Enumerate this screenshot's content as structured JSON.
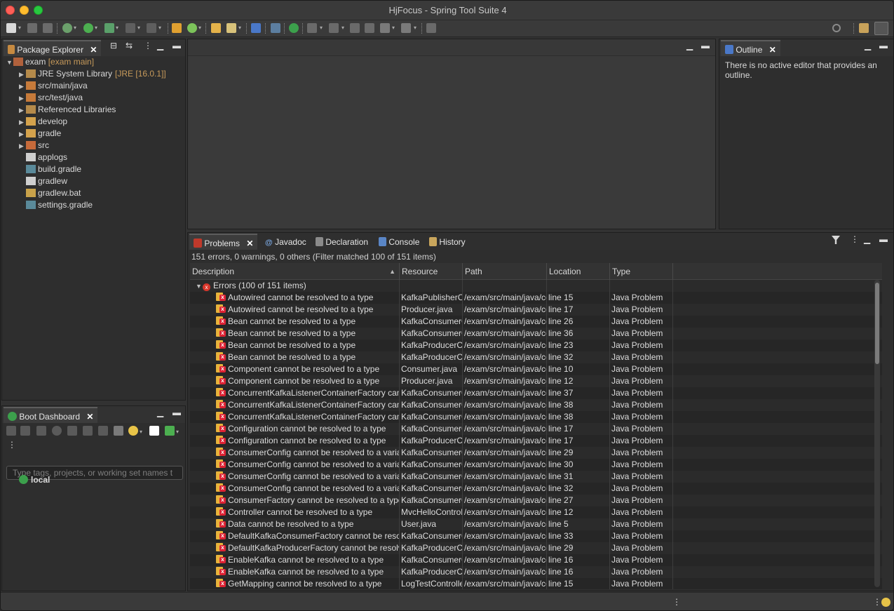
{
  "window": {
    "title": "HjFocus - Spring Tool Suite 4"
  },
  "package_explorer": {
    "tab_label": "Package Explorer",
    "project": {
      "name": "exam",
      "decoration": "[exam main]"
    },
    "children": [
      {
        "label": "JRE System Library",
        "decoration": "[JRE [16.0.1]]",
        "icon": "library-icon",
        "expandable": true
      },
      {
        "label": "src/main/java",
        "decoration": "",
        "icon": "package-folder-error-icon",
        "expandable": true
      },
      {
        "label": "src/test/java",
        "decoration": "",
        "icon": "package-folder-error-icon",
        "expandable": true
      },
      {
        "label": "Referenced Libraries",
        "decoration": "",
        "icon": "library-icon",
        "expandable": true
      },
      {
        "label": "develop",
        "decoration": "",
        "icon": "folder-icon",
        "expandable": true
      },
      {
        "label": "gradle",
        "decoration": "",
        "icon": "folder-icon",
        "expandable": true
      },
      {
        "label": "src",
        "decoration": "",
        "icon": "folder-error-icon",
        "expandable": true
      },
      {
        "label": "applogs",
        "decoration": "",
        "icon": "file-icon",
        "expandable": false
      },
      {
        "label": "build.gradle",
        "decoration": "",
        "icon": "gradle-file-icon",
        "expandable": false
      },
      {
        "label": "gradlew",
        "decoration": "",
        "icon": "file-icon",
        "expandable": false
      },
      {
        "label": "gradlew.bat",
        "decoration": "",
        "icon": "bat-file-icon",
        "expandable": false
      },
      {
        "label": "settings.gradle",
        "decoration": "",
        "icon": "gradle-file-icon",
        "expandable": false
      }
    ]
  },
  "boot_dashboard": {
    "tab_label": "Boot Dashboard",
    "filter_placeholder": "Type tags, projects, or working set names t",
    "items": [
      {
        "label": "local"
      }
    ]
  },
  "outline": {
    "tab_label": "Outline",
    "message": "There is no active editor that provides an outline."
  },
  "bottom_panel": {
    "tabs": [
      {
        "label": "Problems",
        "icon": "problems-icon",
        "active": true
      },
      {
        "label": "Javadoc",
        "icon": "javadoc-icon",
        "active": false
      },
      {
        "label": "Declaration",
        "icon": "declaration-icon",
        "active": false
      },
      {
        "label": "Console",
        "icon": "console-icon",
        "active": false
      },
      {
        "label": "History",
        "icon": "history-icon",
        "active": false
      }
    ],
    "summary": "151 errors, 0 warnings, 0 others (Filter matched 100 of 151 items)",
    "columns": [
      "Description",
      "Resource",
      "Path",
      "Location",
      "Type"
    ],
    "group": "Errors (100 of 151 items)",
    "rows": [
      [
        "Autowired cannot be resolved to a type",
        "KafkaPublisherC",
        "/exam/src/main/java/cc",
        "line 15",
        "Java Problem"
      ],
      [
        "Autowired cannot be resolved to a type",
        "Producer.java",
        "/exam/src/main/java/cc",
        "line 17",
        "Java Problem"
      ],
      [
        "Bean cannot be resolved to a type",
        "KafkaConsumerC",
        "/exam/src/main/java/cc",
        "line 26",
        "Java Problem"
      ],
      [
        "Bean cannot be resolved to a type",
        "KafkaConsumerC",
        "/exam/src/main/java/cc",
        "line 36",
        "Java Problem"
      ],
      [
        "Bean cannot be resolved to a type",
        "KafkaProducerC",
        "/exam/src/main/java/cc",
        "line 23",
        "Java Problem"
      ],
      [
        "Bean cannot be resolved to a type",
        "KafkaProducerC",
        "/exam/src/main/java/cc",
        "line 32",
        "Java Problem"
      ],
      [
        "Component cannot be resolved to a type",
        "Consumer.java",
        "/exam/src/main/java/cc",
        "line 10",
        "Java Problem"
      ],
      [
        "Component cannot be resolved to a type",
        "Producer.java",
        "/exam/src/main/java/cc",
        "line 12",
        "Java Problem"
      ],
      [
        "ConcurrentKafkaListenerContainerFactory cann",
        "KafkaConsumerC",
        "/exam/src/main/java/cc",
        "line 37",
        "Java Problem"
      ],
      [
        "ConcurrentKafkaListenerContainerFactory cann",
        "KafkaConsumerC",
        "/exam/src/main/java/cc",
        "line 38",
        "Java Problem"
      ],
      [
        "ConcurrentKafkaListenerContainerFactory cann",
        "KafkaConsumerC",
        "/exam/src/main/java/cc",
        "line 38",
        "Java Problem"
      ],
      [
        "Configuration cannot be resolved to a type",
        "KafkaConsumerC",
        "/exam/src/main/java/cc",
        "line 17",
        "Java Problem"
      ],
      [
        "Configuration cannot be resolved to a type",
        "KafkaProducerC",
        "/exam/src/main/java/cc",
        "line 17",
        "Java Problem"
      ],
      [
        "ConsumerConfig cannot be resolved to a variab",
        "KafkaConsumerC",
        "/exam/src/main/java/cc",
        "line 29",
        "Java Problem"
      ],
      [
        "ConsumerConfig cannot be resolved to a variab",
        "KafkaConsumerC",
        "/exam/src/main/java/cc",
        "line 30",
        "Java Problem"
      ],
      [
        "ConsumerConfig cannot be resolved to a variab",
        "KafkaConsumerC",
        "/exam/src/main/java/cc",
        "line 31",
        "Java Problem"
      ],
      [
        "ConsumerConfig cannot be resolved to a variab",
        "KafkaConsumerC",
        "/exam/src/main/java/cc",
        "line 32",
        "Java Problem"
      ],
      [
        "ConsumerFactory cannot be resolved to a type",
        "KafkaConsumerC",
        "/exam/src/main/java/cc",
        "line 27",
        "Java Problem"
      ],
      [
        "Controller cannot be resolved to a type",
        "MvcHelloControl",
        "/exam/src/main/java/cc",
        "line 12",
        "Java Problem"
      ],
      [
        "Data cannot be resolved to a type",
        "User.java",
        "/exam/src/main/java/cc",
        "line 5",
        "Java Problem"
      ],
      [
        "DefaultKafkaConsumerFactory cannot be resol",
        "KafkaConsumerC",
        "/exam/src/main/java/cc",
        "line 33",
        "Java Problem"
      ],
      [
        "DefaultKafkaProducerFactory cannot be resolv",
        "KafkaProducerC",
        "/exam/src/main/java/cc",
        "line 29",
        "Java Problem"
      ],
      [
        "EnableKafka cannot be resolved to a type",
        "KafkaConsumerC",
        "/exam/src/main/java/cc",
        "line 16",
        "Java Problem"
      ],
      [
        "EnableKafka cannot be resolved to a type",
        "KafkaProducerC",
        "/exam/src/main/java/cc",
        "line 16",
        "Java Problem"
      ],
      [
        "GetMapping cannot be resolved to a type",
        "LogTestControlle",
        "/exam/src/main/java/cc",
        "line 15",
        "Java Problem"
      ]
    ]
  }
}
